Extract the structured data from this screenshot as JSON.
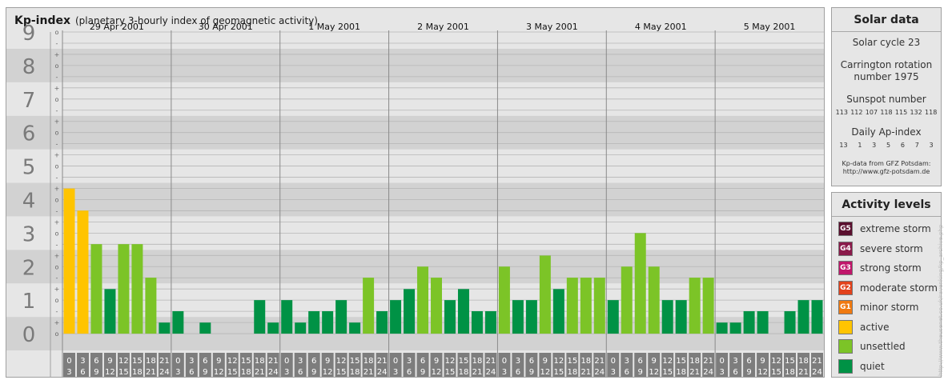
{
  "header": {
    "title": "Kp-index",
    "subtitle": "(planetary 3-hourly index of geomagnetic activity)"
  },
  "chart_data": {
    "type": "bar",
    "title": "Kp-index",
    "subtitle": "(planetary 3-hourly index of geomagnetic activity)",
    "ylim": [
      0,
      9
    ],
    "yticks": [
      "0",
      "1",
      "2",
      "3",
      "4",
      "5",
      "6",
      "7",
      "8",
      "9"
    ],
    "minor_ticks": [
      "o",
      "+",
      "-"
    ],
    "days": [
      "29 Apr 2001",
      "30 Apr 2001",
      "1 May 2001",
      "2 May 2001",
      "3 May 2001",
      "4 May 2001",
      "5 May 2001"
    ],
    "interval_top": [
      "0",
      "3",
      "6",
      "9",
      "12",
      "15",
      "18",
      "21"
    ],
    "interval_bottom": [
      "3",
      "6",
      "9",
      "12",
      "15",
      "18",
      "21",
      "24"
    ],
    "values": [
      4.33,
      3.67,
      2.67,
      1.33,
      2.67,
      2.67,
      1.67,
      0.33,
      0.67,
      0,
      0.33,
      0,
      0,
      0,
      1.0,
      0.33,
      1.0,
      0.33,
      0.67,
      0.67,
      1.0,
      0.33,
      1.67,
      0.67,
      1.0,
      1.33,
      2.0,
      1.67,
      1.0,
      1.33,
      0.67,
      0.67,
      2.0,
      1.0,
      1.0,
      2.33,
      1.33,
      1.67,
      1.67,
      1.67,
      1.0,
      2.0,
      3.0,
      2.0,
      1.0,
      1.0,
      1.67,
      1.67,
      0.33,
      0.33,
      0.67,
      0.67,
      0,
      0.67,
      1.0,
      1.0
    ],
    "levels": [
      "active",
      "active",
      "unsettled",
      "quiet",
      "unsettled",
      "unsettled",
      "unsettled",
      "quiet",
      "quiet",
      "quiet",
      "quiet",
      "quiet",
      "quiet",
      "quiet",
      "quiet",
      "quiet",
      "quiet",
      "quiet",
      "quiet",
      "quiet",
      "quiet",
      "quiet",
      "unsettled",
      "quiet",
      "quiet",
      "quiet",
      "unsettled",
      "unsettled",
      "quiet",
      "quiet",
      "quiet",
      "quiet",
      "unsettled",
      "quiet",
      "quiet",
      "unsettled",
      "quiet",
      "unsettled",
      "unsettled",
      "unsettled",
      "quiet",
      "unsettled",
      "unsettled",
      "unsettled",
      "quiet",
      "quiet",
      "unsettled",
      "unsettled",
      "quiet",
      "quiet",
      "quiet",
      "quiet",
      "quiet",
      "quiet",
      "quiet",
      "quiet"
    ],
    "colors": {
      "active": "#ffc400",
      "unsettled": "#7cc427",
      "quiet": "#009245"
    },
    "grid": true
  },
  "solar": {
    "heading": "Solar data",
    "cycle": "Solar cycle 23",
    "carrington_line1": "Carrington rotation",
    "carrington_line2": "number 1975",
    "sunspot_label": "Sunspot number",
    "sunspot_values": [
      "113",
      "112",
      "107",
      "118",
      "115",
      "132",
      "118"
    ],
    "ap_label": "Daily Ap-index",
    "ap_values": [
      "13",
      "1",
      "3",
      "5",
      "6",
      "7",
      "3"
    ],
    "credit_line1": "Kp-data from GFZ Potsdam:",
    "credit_line2": "http://www.gfz-potsdam.de"
  },
  "activity": {
    "heading": "Activity levels",
    "items": [
      {
        "code": "G5",
        "label": "extreme storm",
        "color": "#5a0f2e"
      },
      {
        "code": "G4",
        "label": "severe storm",
        "color": "#8a1a4a"
      },
      {
        "code": "G3",
        "label": "strong storm",
        "color": "#c0176b"
      },
      {
        "code": "G2",
        "label": "moderate storm",
        "color": "#e2421c"
      },
      {
        "code": "G1",
        "label": "minor storm",
        "color": "#f07a10"
      },
      {
        "code": "",
        "label": "active",
        "color": "#ffc400"
      },
      {
        "code": "",
        "label": "unsettled",
        "color": "#7cc427"
      },
      {
        "code": "",
        "label": "quiet",
        "color": "#009245"
      }
    ]
  },
  "watermark": "http://www.theusenet.co.uk/ravenking/kp_archive.php"
}
